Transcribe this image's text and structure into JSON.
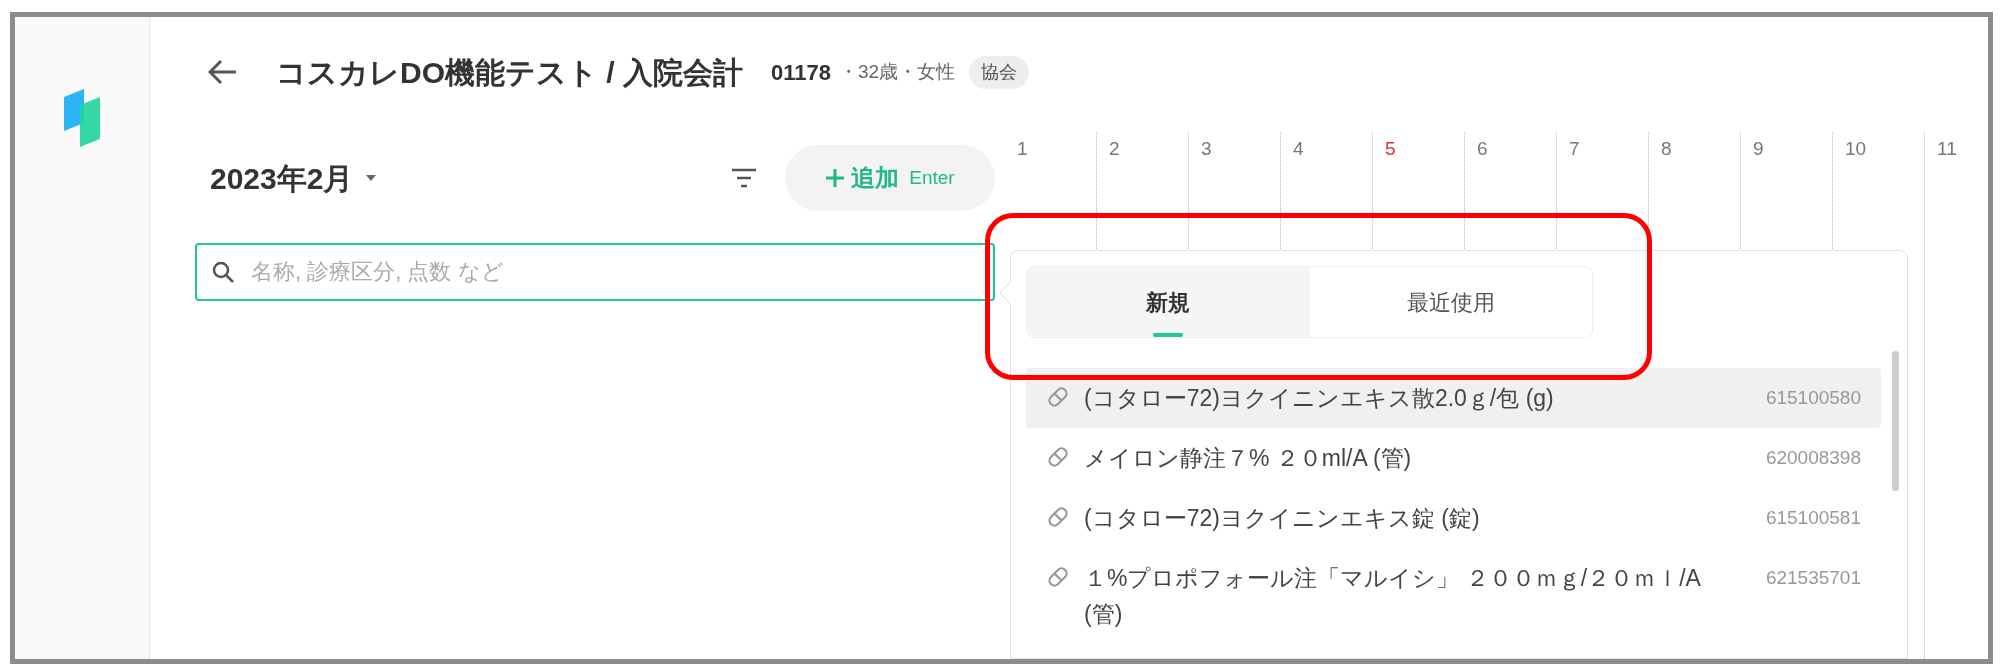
{
  "header": {
    "title": "コスカレDO機能テスト / 入院会計",
    "patient_id": "01178",
    "patient_info": "・32歳・女性",
    "badge": "協会"
  },
  "month": "2023年2月",
  "add_button": {
    "label": "追加",
    "shortcut": "Enter"
  },
  "search": {
    "placeholder": "名称, 診療区分, 点数 など"
  },
  "days": [
    {
      "label": "1",
      "holiday": false
    },
    {
      "label": "2",
      "holiday": false
    },
    {
      "label": "3",
      "holiday": false
    },
    {
      "label": "4",
      "holiday": false
    },
    {
      "label": "5",
      "holiday": true
    },
    {
      "label": "6",
      "holiday": false
    },
    {
      "label": "7",
      "holiday": false
    },
    {
      "label": "8",
      "holiday": false
    },
    {
      "label": "9",
      "holiday": false
    },
    {
      "label": "10",
      "holiday": false
    },
    {
      "label": "11",
      "holiday": false
    }
  ],
  "popup": {
    "tabs": [
      {
        "label": "新規",
        "selected": true
      },
      {
        "label": "最近使用",
        "selected": false
      }
    ],
    "items": [
      {
        "name": "(コタロー72)ヨクイニンエキス散2.0ｇ/包 (g)",
        "code": "615100580",
        "selected": true
      },
      {
        "name": "メイロン静注７% ２０ml/A (管)",
        "code": "620008398",
        "selected": false
      },
      {
        "name": "(コタロー72)ヨクイニンエキス錠 (錠)",
        "code": "615100581",
        "selected": false
      },
      {
        "name": "１%プロポフォール注「マルイシ」 ２００ｍｇ/２０ｍｌ/A (管)",
        "code": "621535701",
        "selected": false
      }
    ]
  }
}
